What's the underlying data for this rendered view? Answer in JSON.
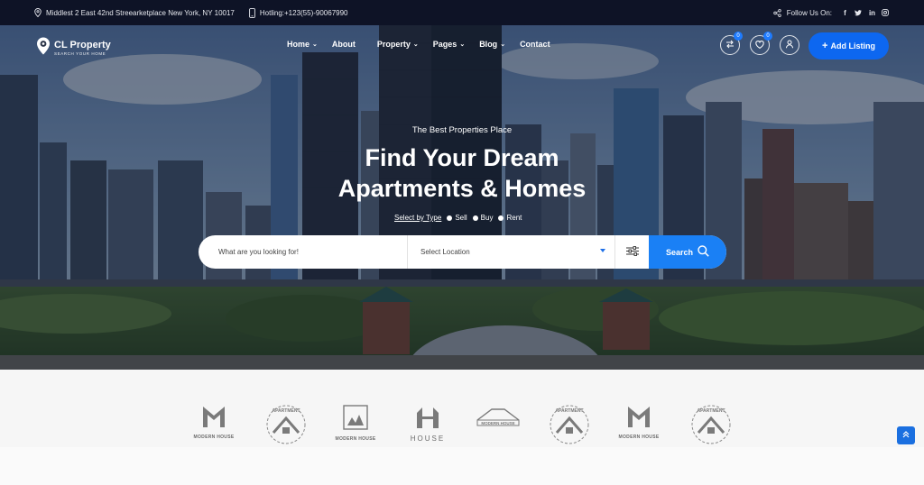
{
  "topbar": {
    "address": "Middlest 2 East 42nd Streearketplace New York, NY 10017",
    "hotline": "Hotling:+123(55)-90067990",
    "follow_label": "Follow Us On:",
    "social": [
      "facebook-icon",
      "twitter-icon",
      "linkedin-icon",
      "instagram-icon"
    ]
  },
  "header": {
    "logo_name": "CL Property",
    "logo_tagline": "SEARCH YOUR HOME",
    "nav": [
      {
        "label": "Home",
        "dropdown": true
      },
      {
        "label": "About",
        "dropdown": false
      },
      {
        "label": "Property",
        "dropdown": true
      },
      {
        "label": "Pages",
        "dropdown": true
      },
      {
        "label": "Blog",
        "dropdown": true
      },
      {
        "label": "Contact",
        "dropdown": false
      }
    ],
    "compare_count": "0",
    "wishlist_count": "0",
    "add_listing": "Add Listing",
    "add_listing_plus": "+"
  },
  "hero": {
    "subtitle": "The Best Properties Place",
    "title_line1": "Find Your Dream",
    "title_line2": "Apartments & Homes",
    "type_label": "Select by Type",
    "types": [
      "Sell",
      "Buy",
      "Rent"
    ]
  },
  "search": {
    "placeholder": "What are you looking for!",
    "location": "Select Location",
    "button": "Search"
  },
  "brands": [
    {
      "icon": "m-house-logo",
      "caption": "MODERN HOUSE"
    },
    {
      "icon": "apartment-circle-logo",
      "caption": "APARTMENT"
    },
    {
      "icon": "framed-house-logo",
      "caption": "MODERN HOUSE"
    },
    {
      "icon": "h-house-logo",
      "caption": "HOUSE"
    },
    {
      "icon": "roof-logo",
      "caption": "MODERN HOUSE"
    },
    {
      "icon": "apartment-circle-logo",
      "caption": "APARTMENT"
    },
    {
      "icon": "m-house-logo",
      "caption": "MODERN HOUSE"
    },
    {
      "icon": "apartment-circle-logo",
      "caption": "APARTMENT"
    }
  ],
  "colors": {
    "topbar": "#0e1326",
    "accent": "#1a80f5",
    "add_listing": "#0d67f0",
    "logo_gray": "#6b6b6b"
  }
}
